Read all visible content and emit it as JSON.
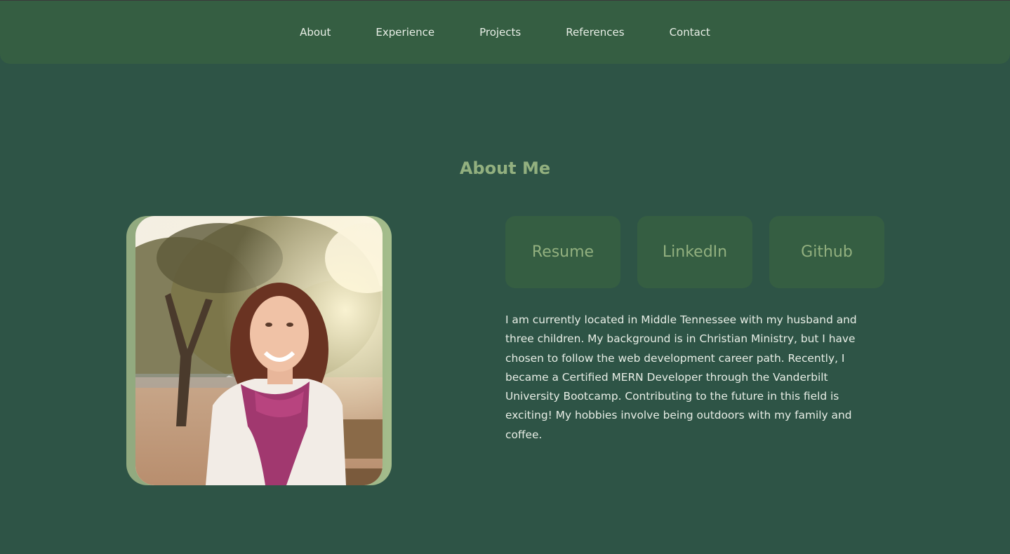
{
  "nav": {
    "items": [
      {
        "label": "About"
      },
      {
        "label": "Experience"
      },
      {
        "label": "Projects"
      },
      {
        "label": "References"
      },
      {
        "label": "Contact"
      }
    ]
  },
  "about": {
    "title": "About Me",
    "photo": {
      "icon": "portrait-photo"
    },
    "links": [
      {
        "label": "Resume"
      },
      {
        "label": "LinkedIn"
      },
      {
        "label": "Github"
      }
    ],
    "bio": "I am currently located in Middle Tennessee with my husband and three children. My background is in Christian Ministry, but I have chosen to follow the web development career path. Recently, I became a Certified MERN Developer through the Vanderbilt University Bootcamp. Contributing to the future in this field is exciting! My hobbies involve being outdoors with my family and coffee."
  },
  "colors": {
    "background": "#2e5446",
    "navbar": "#355e42",
    "accent": "#92b07f",
    "text": "#e8eee6"
  }
}
